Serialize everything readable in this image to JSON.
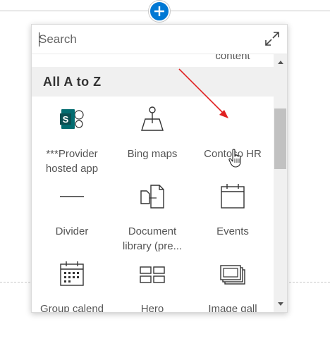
{
  "canvas": {
    "add_section_icon": "plus-circle-icon"
  },
  "toolbox": {
    "search": {
      "placeholder": "Search",
      "value": ""
    },
    "expand_icon": "expand-icon",
    "partial_item_label": "content",
    "section_title": "All A to Z",
    "items": [
      {
        "label": "***Provider hosted app",
        "icon": "sharepoint-app-icon"
      },
      {
        "label": "Bing maps",
        "icon": "map-pin-icon"
      },
      {
        "label": "Contoso HR",
        "icon": ""
      },
      {
        "label": "Divider",
        "icon": "divider-line-icon"
      },
      {
        "label": "Document library (pre...",
        "icon": "document-library-icon"
      },
      {
        "label": "Events",
        "icon": "calendar-icon"
      },
      {
        "label": "Group calend",
        "icon": "group-calendar-icon"
      },
      {
        "label": "Hero",
        "icon": "hero-layout-icon"
      },
      {
        "label": "Image gall",
        "icon": "image-gallery-icon"
      }
    ]
  },
  "colors": {
    "accent": "#0078d4",
    "annotation_arrow": "#e02020",
    "sharepoint_tile": "#036c70"
  }
}
